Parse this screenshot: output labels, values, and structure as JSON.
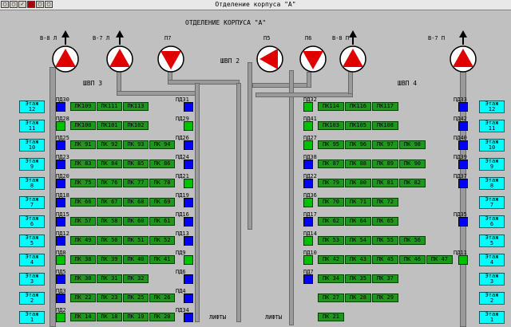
{
  "window": {
    "title": "Отделение корпуса \"А\"",
    "btn_labels": [
      "▢",
      "▢",
      "✓",
      "▢",
      "▢",
      "▢"
    ]
  },
  "header": {
    "title": "ОТДЕЛЕНИЕ КОРПУСА \"А\""
  },
  "shafts": {
    "left": "ШВП 3",
    "center": "ШВП 2",
    "right": "ШВП 4"
  },
  "fans": [
    {
      "label": "В-8 Л",
      "dir": "up"
    },
    {
      "label": "В-7 Л",
      "dir": "up"
    },
    {
      "label": "П7",
      "dir": "down"
    },
    {
      "label": "П5",
      "dir": "left"
    },
    {
      "label": "П6",
      "dir": "down"
    },
    {
      "label": "В-8 П",
      "dir": "up"
    },
    {
      "label": "В-7 П",
      "dir": "up"
    }
  ],
  "floors_left": [
    "Этаж 12",
    "Этаж 11",
    "Этаж 10",
    "Этаж 9",
    "Этаж 8",
    "Этаж 7",
    "Этаж 6",
    "Этаж 5",
    "Этаж 4",
    "Этаж 3",
    "Этаж 2",
    "Этаж 1"
  ],
  "floors_right": [
    "Этаж 12",
    "Этаж 11",
    "Этаж 10",
    "Этаж 9",
    "Этаж 8",
    "Этаж 7",
    "Этаж 6",
    "Этаж 5",
    "Этаж 4",
    "Этаж 3",
    "Этаж 2",
    "Этаж 1"
  ],
  "lifts": {
    "left": "ЛИФТЫ",
    "right": "ЛИФТЫ"
  },
  "left_rows": [
    {
      "pd_l": "ПД30",
      "pd_r": "ПД31",
      "pk": [
        "ПК109",
        "ПК111",
        "ПК113"
      ]
    },
    {
      "pd_l": "ПД28",
      "pd_r": "ПД29",
      "pk": [
        "ПК100",
        "ПК101",
        "ПК102"
      ]
    },
    {
      "pd_l": "ПД25",
      "pd_r": "ПД26",
      "pk": [
        "ПК 91",
        "ПК 92",
        "ПК 93",
        "ПК 94"
      ]
    },
    {
      "pd_l": "ПД23",
      "pd_r": "ПД24",
      "pk": [
        "ПК 83",
        "ПК 84",
        "ПК 85",
        "ПК 86"
      ]
    },
    {
      "pd_l": "ПД20",
      "pd_r": "ПД21",
      "pk": [
        "ПК 75",
        "ПК 76",
        "ПК 77",
        "ПК 78"
      ]
    },
    {
      "pd_l": "ПД18",
      "pd_r": "ПД19",
      "pk": [
        "ПК 66",
        "ПК 67",
        "ПК 68",
        "ПК 69"
      ]
    },
    {
      "pd_l": "ПД15",
      "pd_r": "ПД16",
      "pk": [
        "ПК 57",
        "ПК 58",
        "ПК 60",
        "ПК 61"
      ]
    },
    {
      "pd_l": "ПД12",
      "pd_r": "ПД13",
      "pk": [
        "ПК 49",
        "ПК 50",
        "ПК 51",
        "ПК 52"
      ]
    },
    {
      "pd_l": "ПД8",
      "pd_r": "ПД9",
      "pk": [
        "ПК 38",
        "ПК 39",
        "ПК 40",
        "ПК 41"
      ]
    },
    {
      "pd_l": "ПД5",
      "pd_r": "ПД6",
      "pk": [
        "ПК 30",
        "ПК 31",
        "ПК 32"
      ]
    },
    {
      "pd_l": "ПД3",
      "pd_r": "ПД4",
      "pk": [
        "ПК 22",
        "ПК 23",
        "ПК 25",
        "ПК 26"
      ]
    },
    {
      "pd_l": "ПД2",
      "pd_r": "ПД34",
      "pk": [
        "ПК 14",
        "ПК 18",
        "ПК 19",
        "ПК 20"
      ]
    }
  ],
  "right_rows": [
    {
      "pd_l": "ПД32",
      "pd_r": "ПД33",
      "pk": [
        "ПК114",
        "ПК116",
        "ПК117"
      ]
    },
    {
      "pd_l": "ПД41",
      "pd_r": "ПД42",
      "pk": [
        "ПК103",
        "ПК105",
        "ПК108"
      ]
    },
    {
      "pd_l": "ПД27",
      "pd_r": "ПД40",
      "pk": [
        "ПК 95",
        "ПК 96",
        "ПК 97",
        "ПК 98"
      ]
    },
    {
      "pd_l": "ПД38",
      "pd_r": "ПД39",
      "pk": [
        "ПК 87",
        "ПК 88",
        "ПК 89",
        "ПК 90"
      ]
    },
    {
      "pd_l": "ПД22",
      "pd_r": "ПД37",
      "pk": [
        "ПК 79",
        "ПК 80",
        "ПК 81",
        "ПК 82"
      ]
    },
    {
      "pd_l": "ПД36",
      "pd_r": "",
      "pk": [
        "ПК 70",
        "ПК 71",
        "ПК 72"
      ]
    },
    {
      "pd_l": "ПД17",
      "pd_r": "ПД35",
      "pk": [
        "ПК 62",
        "ПК 64",
        "ПК 65"
      ]
    },
    {
      "pd_l": "ПД14",
      "pd_r": "",
      "pk": [
        "ПК 53",
        "ПК 54",
        "ПК 55",
        "ПК 56"
      ]
    },
    {
      "pd_l": "ПД10",
      "pd_r": "ПД11",
      "pk": [
        "ПК 42",
        "ПК 43",
        "ПК 45",
        "ПК 46",
        "ПК 47"
      ]
    },
    {
      "pd_l": "ПД7",
      "pd_r": "",
      "pk": [
        "ПК 34",
        "ПК 35",
        "ПК 37"
      ]
    },
    {
      "pd_l": "",
      "pd_r": "",
      "pk": [
        "ПК 27",
        "ПК 28",
        "ПК 29"
      ]
    },
    {
      "pd_l": "",
      "pd_r": "",
      "pk": [
        "ПК 21"
      ]
    }
  ],
  "colors": {
    "bg": "#c0c0c0",
    "floor": "#00ffff",
    "pk": "#1a9a1a",
    "damper_open": "#00c000",
    "damper_closed": "#0000ff",
    "fan": "#e00000"
  }
}
